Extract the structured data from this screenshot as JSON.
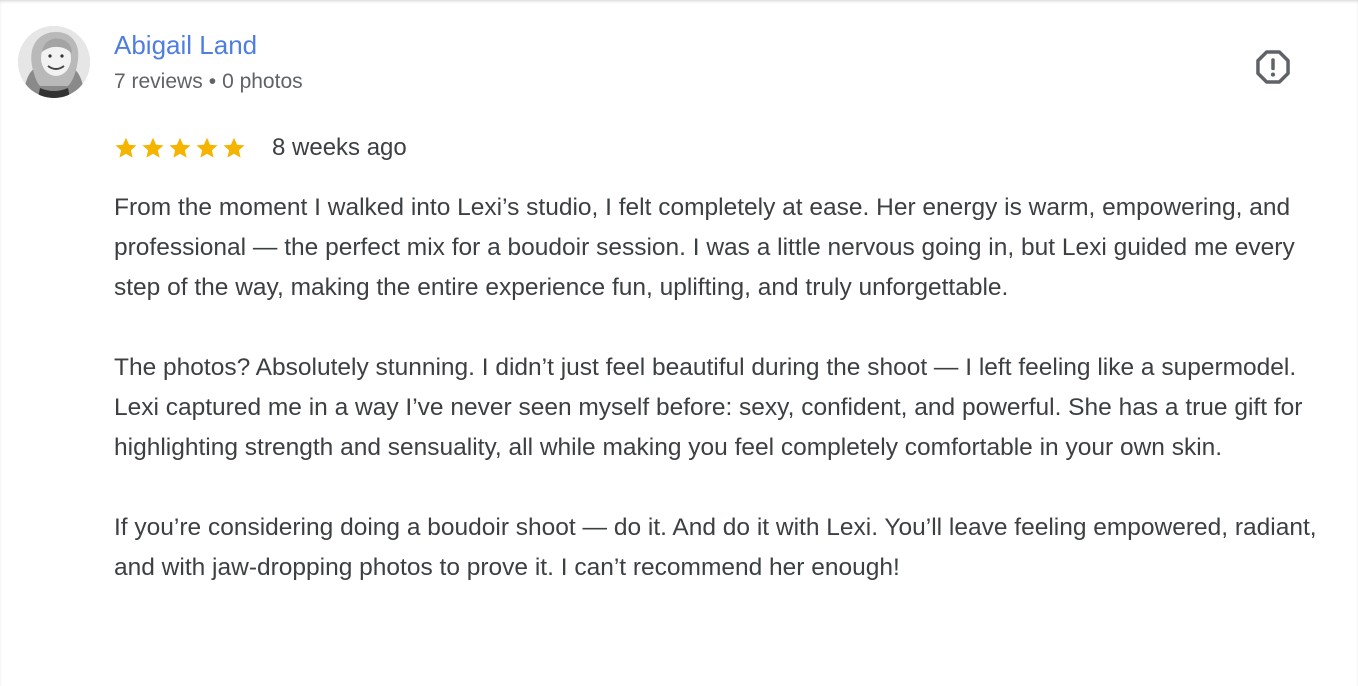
{
  "reviewer": {
    "name": "Abigail Land",
    "reviews_count": "7 reviews",
    "separator": "•",
    "photos_count": "0 photos",
    "avatar_icon": "avatar-photo-icon"
  },
  "report": {
    "icon": "report-flag-icon"
  },
  "rating": {
    "stars": 5,
    "max_stars": 5,
    "star_color": "#f4b400",
    "date": "8 weeks ago"
  },
  "review": {
    "paragraphs": [
      "From the moment I walked into Lexi’s studio, I felt completely at ease. Her energy is warm, empowering, and professional — the perfect mix for a boudoir session. I was a little nervous going in, but Lexi guided me every step of the way, making the entire experience fun, uplifting, and truly unforgettable.",
      "The photos? Absolutely stunning. I didn’t just feel beautiful during the shoot — I left feeling like a supermodel. Lexi captured me in a way I’ve never seen myself before: sexy, confident, and powerful. She has a true gift for highlighting strength and sensuality, all while making you feel completely comfortable in your own skin.",
      "If you’re considering doing a boudoir shoot — do it. And do it with Lexi. You’ll leave feeling empowered, radiant, and with jaw-dropping photos to prove it. I can’t recommend her enough!"
    ]
  },
  "colors": {
    "name_link": "#4f7ee0",
    "meta_text": "#5f6368",
    "body_text": "#3c4043",
    "icon": "#5f6368"
  }
}
